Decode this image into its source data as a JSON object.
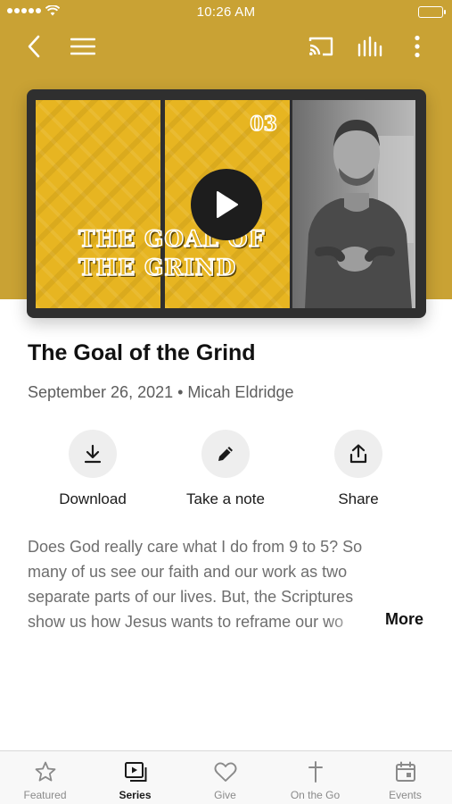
{
  "status_bar": {
    "time": "10:26 AM"
  },
  "nav": {
    "back_icon": "chevron-left-icon",
    "menu_icon": "hamburger-menu-icon",
    "cast_icon": "cast-icon",
    "audio_icon": "audio-levels-icon",
    "more_icon": "more-vertical-icon"
  },
  "theme": {
    "header_color": "#c9a234",
    "artwork_yellow": "#e7b521"
  },
  "video": {
    "episode_number": "03",
    "artwork_title": "THE GOAL OF\nTHE GRIND",
    "play_icon": "play-icon"
  },
  "episode": {
    "title": "The Goal of the Grind",
    "meta": "September 26, 2021 • Micah Eldridge"
  },
  "actions": [
    {
      "label": "Download",
      "icon": "download-icon"
    },
    {
      "label": "Take a note",
      "icon": "pencil-icon"
    },
    {
      "label": "Share",
      "icon": "share-icon"
    }
  ],
  "description": {
    "lines": [
      "Does God really care what I do from 9 to 5? So",
      "many of us see our faith and our work as two",
      "separate parts of our lives. But, the Scriptures",
      "show us how Jesus wants to reframe our wo"
    ],
    "more_label": "More"
  },
  "tabs": [
    {
      "label": "Featured",
      "icon": "star-icon",
      "active": false
    },
    {
      "label": "Series",
      "icon": "video-library-icon",
      "active": true
    },
    {
      "label": "Give",
      "icon": "heart-icon",
      "active": false
    },
    {
      "label": "On the Go",
      "icon": "cross-icon",
      "active": false
    },
    {
      "label": "Events",
      "icon": "calendar-icon",
      "active": false
    }
  ]
}
